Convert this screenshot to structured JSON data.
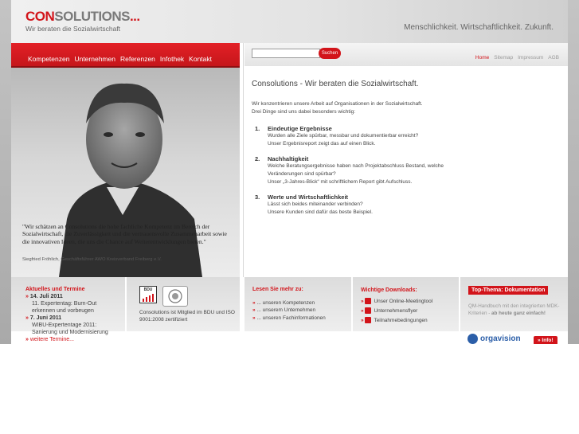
{
  "header": {
    "brand_strong": "CON",
    "brand_rest": "SOLUTIONS",
    "brand_dots": "...",
    "tagline": "Wir beraten die Sozialwirtschaft",
    "slogan": "Menschlichkeit. Wirtschaftlichkeit. Zukunft."
  },
  "nav": {
    "items": [
      {
        "label": "Kompetenzen"
      },
      {
        "label": "Unternehmen"
      },
      {
        "label": "Referenzen"
      },
      {
        "label": "Infothek"
      },
      {
        "label": "Kontakt"
      }
    ]
  },
  "search": {
    "placeholder": "",
    "button_label": "Suchen"
  },
  "metanav": {
    "items": [
      {
        "label": "Home"
      },
      {
        "label": "Sitemap"
      },
      {
        "label": "Impressum"
      },
      {
        "label": "AGB"
      }
    ]
  },
  "quote": {
    "text": "\"Wir schätzen an Consolutions die hohe fachliche Kompetenz im Bereich der Sozialwirtschaft, die Zuverlässigkeit und die vertrauensvolle Zusammenarbeit sowie die innovativen Ideen, die uns die Chance auf Weiterentwicklungen bieten.\"",
    "author": "Siegfried Fröhlich, Geschäftsführer AWO Kreisverband Freiberg e.V."
  },
  "content": {
    "title": "Consolutions - Wir beraten die Sozialwirtschaft.",
    "intro_1": "Wir konzentrieren unsere Arbeit auf Organisationen in der Sozialwirtschaft.",
    "intro_2": "Drei Dinge sind uns dabei besonders wichtig:",
    "points": [
      {
        "num": "1.",
        "title": "Eindeutige Ergebnisse",
        "lines": [
          "Wurden alle Ziele spürbar, messbar und dokumentierbar erreicht?",
          "Unser Ergebnisreport zeigt das auf einen Blick."
        ]
      },
      {
        "num": "2.",
        "title": "Nachhaltigkeit",
        "lines": [
          "Welche Beratungsergebnisse haben nach Projektabschluss Bestand, welche",
          "Veränderungen sind spürbar?",
          "Unser „3-Jahres-Blick“ mit schriftlichem Report gibt Aufschluss."
        ]
      },
      {
        "num": "3.",
        "title": "Werte und Wirtschaftlichkeit",
        "lines": [
          "Lässt sich beides miteinander verbinden?",
          "Unsere Kunden sind dafür das beste Beispiel."
        ]
      }
    ]
  },
  "termine": {
    "title": "Aktuelles und Termine",
    "items": [
      {
        "date": "14. Juli 2011",
        "lines": [
          "11. Expertentag: Burn-Out",
          "erkennen und vorbeugen"
        ]
      },
      {
        "date": "7. Juni 2011",
        "lines": [
          "WIBU-Expertentage 2011:",
          "Sanierung und Modernisierung"
        ]
      }
    ],
    "more": "weitere Termine..."
  },
  "bdu": {
    "logo_text": "BDU",
    "text": "Consolutions ist Mitglied im BDU und ISO 9001:2008 zertifiziert"
  },
  "lesen": {
    "title": "Lesen Sie mehr zu:",
    "items": [
      {
        "label": "... unseren Kompetenzen"
      },
      {
        "label": "... unserem Unternehmen"
      },
      {
        "label": "... unseren Fachinformationen"
      }
    ]
  },
  "downloads": {
    "title": "Wichtige Downloads:",
    "items": [
      {
        "label": "Unser Online-Meetingtool"
      },
      {
        "label": "Unternehmensflyer"
      },
      {
        "label": "Teilnahmebedingungen"
      }
    ]
  },
  "topthema": {
    "badge": "Top-Thema: Dokumentation",
    "text": "QM-Handbuch mit den integrierten MDK-Kriterien -",
    "text_bold": "ab heute ganz einfach!",
    "orgavision": "orgavision",
    "info_button": "» Info!"
  },
  "colors": {
    "accent": "#d2141a",
    "gray_text": "#444444",
    "footer_bg": "#dcdcdc"
  },
  "icons": {
    "search": "search-icon",
    "download": "download-icon",
    "arrow": "arrow-icon"
  }
}
